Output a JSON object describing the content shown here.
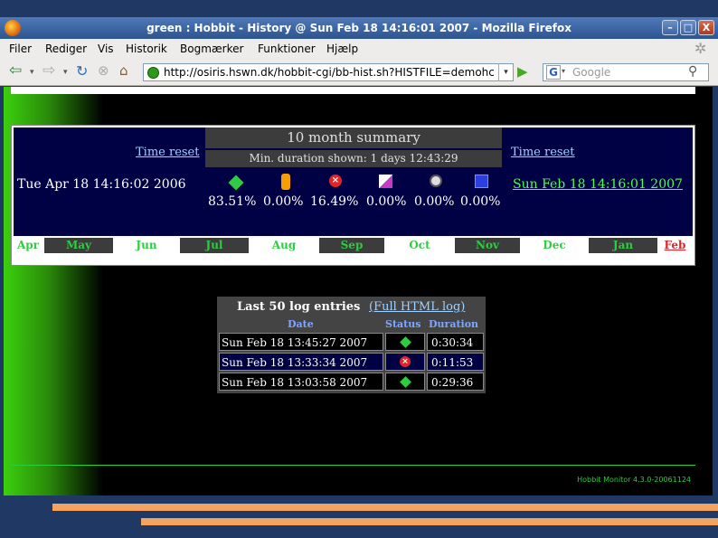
{
  "window": {
    "title": "green : Hobbit - History @ Sun Feb 18 14:16:01 2007 - Mozilla Firefox"
  },
  "menu": [
    "Filer",
    "Rediger",
    "Vis",
    "Historik",
    "Bogmærker",
    "Funktioner",
    "Hjælp"
  ],
  "toolbar": {
    "url": "http://osiris.hswn.dk/hobbit-cgi/bb-hist.sh?HISTFILE=demohc",
    "search_placeholder": "Google",
    "search_engine_letter": "G"
  },
  "summary": {
    "title": "10 month summary",
    "min_duration": "Min. duration shown: 1 days 12:43:29",
    "time_reset_left": "Time reset",
    "time_reset_right": "Time reset",
    "start_date": "Tue Apr 18 14:16:02 2006",
    "end_date": "Sun Feb 18 14:16:01 2007",
    "stats": [
      {
        "icon": "green-icon",
        "value": "83.51%"
      },
      {
        "icon": "yellow-icon",
        "value": "0.00%"
      },
      {
        "icon": "red-icon",
        "value": "16.49%"
      },
      {
        "icon": "purple-icon",
        "value": "0.00%"
      },
      {
        "icon": "clear-icon",
        "value": "0.00%"
      },
      {
        "icon": "blue-icon",
        "value": "0.00%"
      }
    ],
    "months": [
      "Apr",
      "May",
      "Jun",
      "Jul",
      "Aug",
      "Sep",
      "Oct",
      "Nov",
      "Dec",
      "Jan",
      "Feb"
    ]
  },
  "log": {
    "title": "Last 50 log entries",
    "full_link": "(Full HTML log)",
    "columns": [
      "Date",
      "Status",
      "Duration"
    ],
    "rows": [
      {
        "date": "Sun Feb 18 13:45:27 2007",
        "status": "green-icon",
        "duration": "0:30:34"
      },
      {
        "date": "Sun Feb 18 13:33:34 2007",
        "status": "red-icon",
        "duration": "0:11:53"
      },
      {
        "date": "Sun Feb 18 13:03:58 2007",
        "status": "green-icon",
        "duration": "0:29:36"
      }
    ]
  },
  "footer": "Hobbit Monitor 4.3.0-20061124",
  "colors": {
    "green": "#2ecc40",
    "red": "#e0242a",
    "link": "#9fd2ff",
    "navy": "#000044"
  }
}
